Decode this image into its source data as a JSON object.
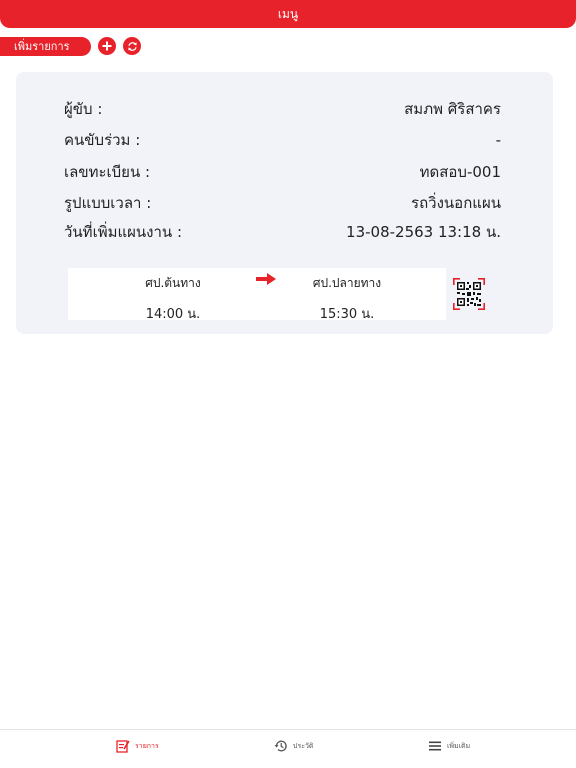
{
  "header": {
    "title": "เมนู"
  },
  "toolbar": {
    "add_list_label": "เพิ่มรายการ",
    "add_icon": "plus-icon",
    "refresh_icon": "refresh-icon"
  },
  "card": {
    "rows": [
      {
        "label": "ผู้ขับ :",
        "value": "สมภพ  ศิริสาคร"
      },
      {
        "label": "คนขับร่วม :",
        "value": "-"
      },
      {
        "label": "เลขทะเบียน :",
        "value": "ทดสอบ-001"
      },
      {
        "label": "รูปแบบเวลา :",
        "value": "รถวิ่งนอกแผน"
      },
      {
        "label": "วันที่เพิ่มแผนงาน :",
        "value": "13-08-2563 13:18 น."
      }
    ],
    "route": {
      "origin_name": "ศป.ต้นทาง",
      "origin_time": "14:00 น.",
      "dest_name": "ศป.ปลายทาง",
      "dest_time": "15:30 น."
    }
  },
  "colors": {
    "accent": "#e8222a",
    "card_bg": "#f1f3f8"
  },
  "nav": {
    "items": [
      {
        "label": "รายการ",
        "icon": "list-edit-icon",
        "active": true
      },
      {
        "label": "ประวัติ",
        "icon": "history-icon",
        "active": false
      },
      {
        "label": "เพิ่มเติม",
        "icon": "menu-icon",
        "active": false
      }
    ]
  }
}
